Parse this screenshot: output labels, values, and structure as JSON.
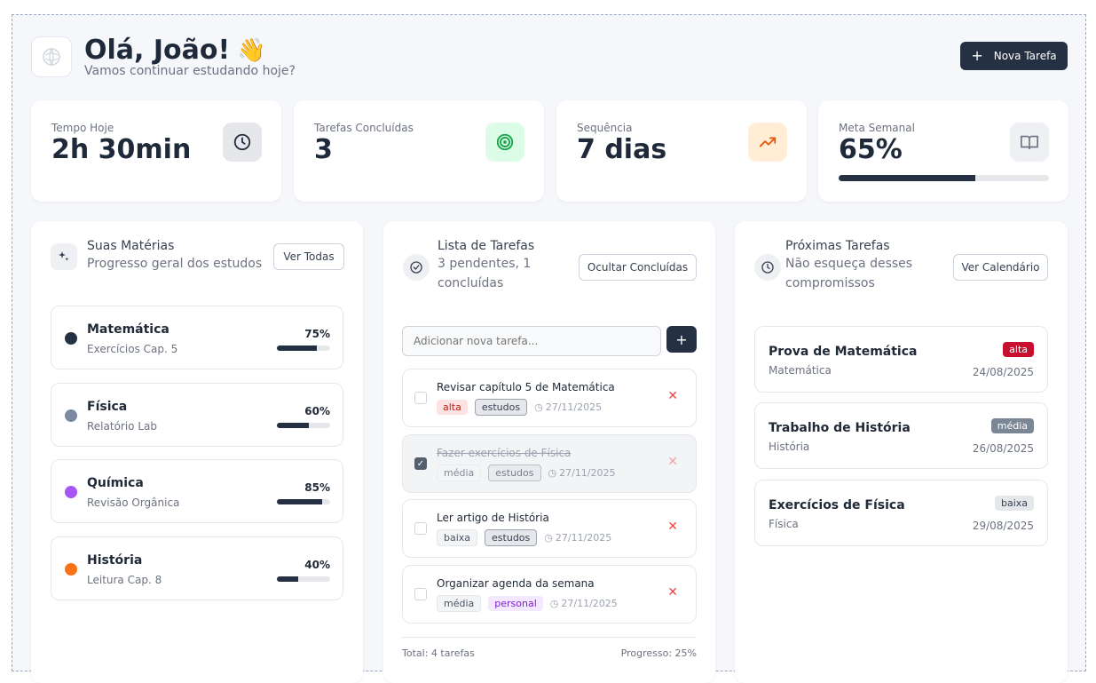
{
  "header": {
    "greeting": "Olá, João!",
    "wave": "👋",
    "subtitle": "Vamos continuar estudando hoje?",
    "new_task_label": "Nova Tarefa"
  },
  "stats": [
    {
      "label": "Tempo Hoje",
      "value": "2h 30min",
      "icon": "clock-icon",
      "icon_bg": "#e5e7eb"
    },
    {
      "label": "Tarefas Concluídas",
      "value": "3",
      "icon": "target-icon",
      "icon_bg": "#dcfce7"
    },
    {
      "label": "Sequência",
      "value": "7 dias",
      "icon": "trending-up-icon",
      "icon_bg": "#ffedd5"
    },
    {
      "label": "Meta Semanal",
      "value": "65%",
      "icon": "book-icon",
      "icon_bg": "#eef0f4",
      "progress": 0.65
    }
  ],
  "subjects_panel": {
    "title": "Suas Matérias",
    "subtitle": "Progresso geral dos estudos",
    "button": "Ver Todas",
    "items": [
      {
        "name": "Matemática",
        "desc": "Exercícios Cap. 5",
        "pct": "75%",
        "progress": 0.75,
        "color": "#253142"
      },
      {
        "name": "Física",
        "desc": "Relatório Lab",
        "pct": "60%",
        "progress": 0.6,
        "color": "#7b8aa0"
      },
      {
        "name": "Química",
        "desc": "Revisão Orgânica",
        "pct": "85%",
        "progress": 0.85,
        "color": "#a855f7"
      },
      {
        "name": "História",
        "desc": "Leitura Cap. 8",
        "pct": "40%",
        "progress": 0.4,
        "color": "#f97316"
      }
    ]
  },
  "tasks_panel": {
    "title": "Lista de Tarefas",
    "subtitle_line1": "3 pendentes, 1",
    "subtitle_line2": "concluídas",
    "button": "Ocultar Concluídas",
    "input_placeholder": "Adicionar nova tarefa...",
    "tasks": [
      {
        "title": "Revisar capítulo 5 de Matemática",
        "priority": "alta",
        "category": "estudos",
        "date": "27/11/2025",
        "done": false
      },
      {
        "title": "Fazer exercícios de Física",
        "priority": "média",
        "category": "estudos",
        "date": "27/11/2025",
        "done": true
      },
      {
        "title": "Ler artigo de História",
        "priority": "baixa",
        "category": "estudos",
        "date": "27/11/2025",
        "done": false
      },
      {
        "title": "Organizar agenda da semana",
        "priority": "média",
        "category": "personal",
        "date": "27/11/2025",
        "done": false
      }
    ],
    "footer_total": "Total: 4 tarefas",
    "footer_progress": "Progresso: 25%"
  },
  "upcoming_panel": {
    "title": "Próximas Tarefas",
    "subtitle_line1": "Não esqueça desses",
    "subtitle_line2": "compromissos",
    "button": "Ver Calendário",
    "items": [
      {
        "title": "Prova de Matemática",
        "subject": "Matemática",
        "badge": "alta",
        "date": "24/08/2025"
      },
      {
        "title": "Trabalho de História",
        "subject": "História",
        "badge": "média",
        "date": "26/08/2025"
      },
      {
        "title": "Exercícios de Física",
        "subject": "Física",
        "badge": "baixa",
        "date": "29/08/2025"
      }
    ]
  }
}
